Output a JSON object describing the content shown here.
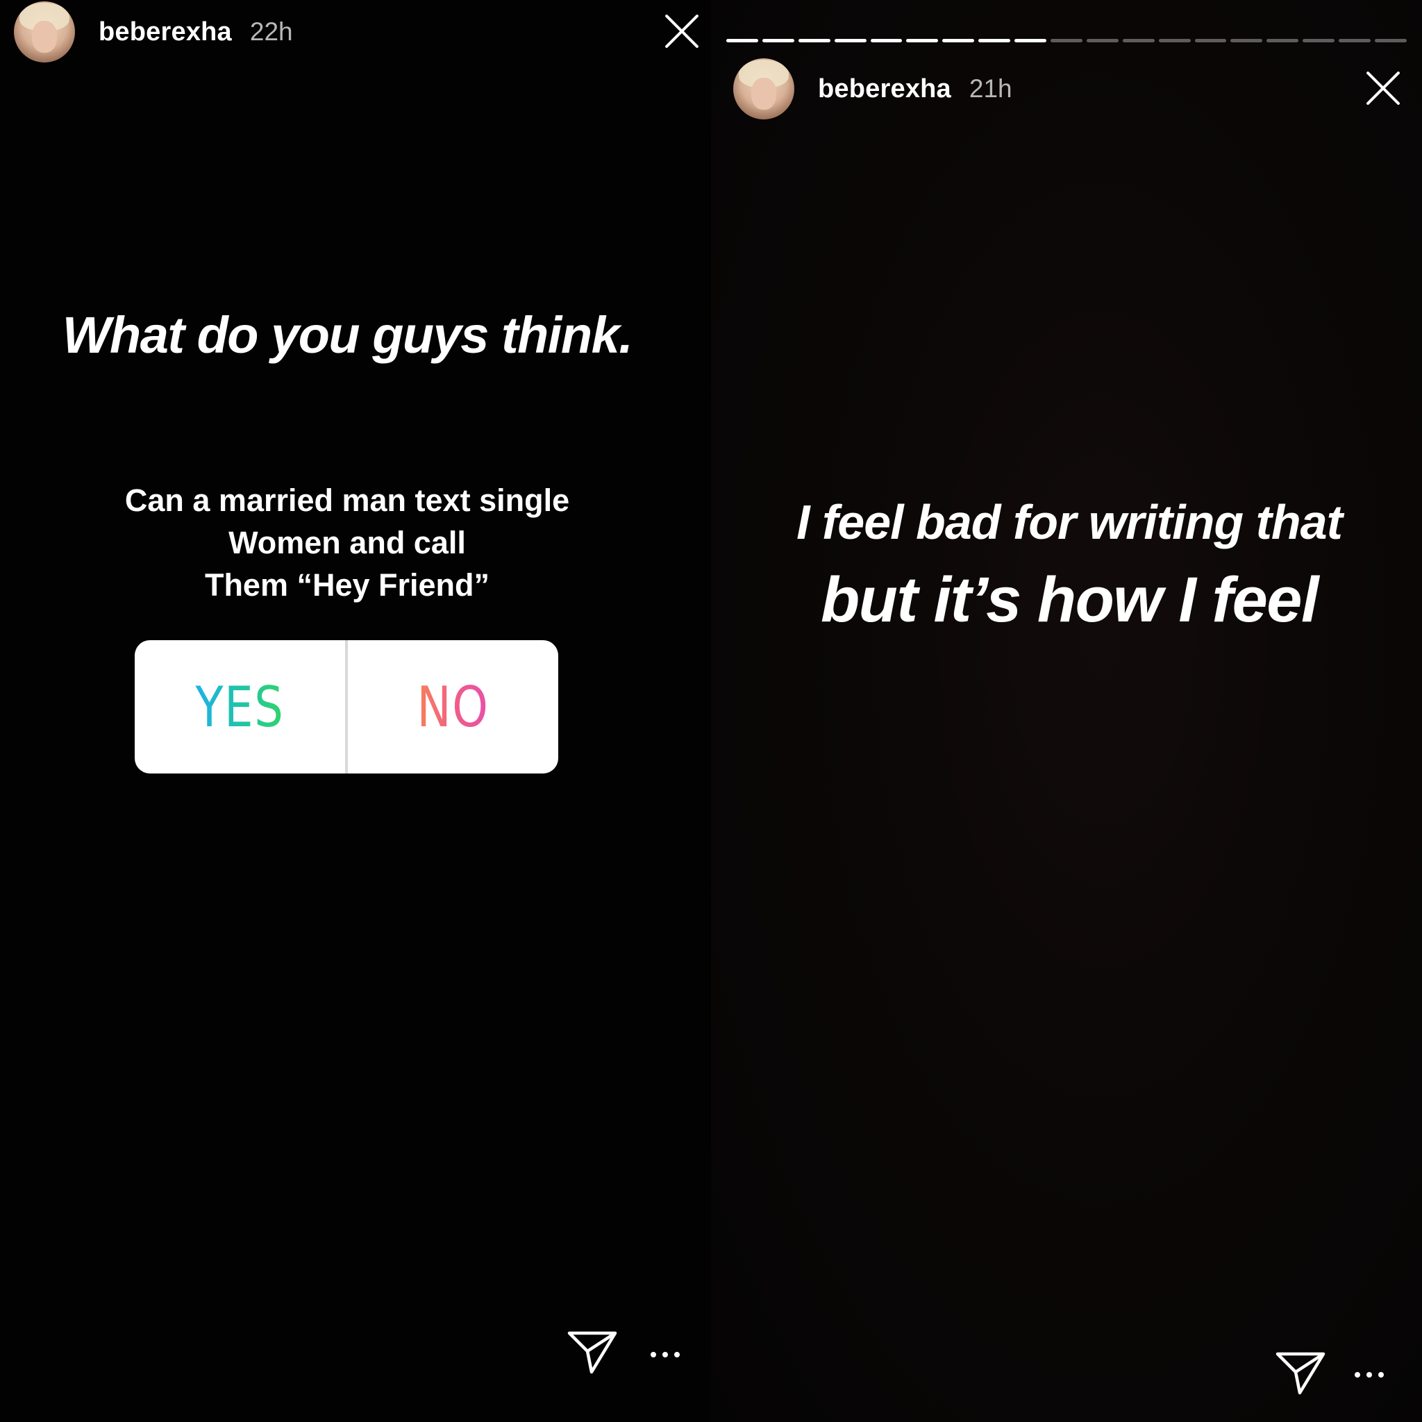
{
  "left_story": {
    "username": "beberexha",
    "time": "22h",
    "title": "What do you guys think.",
    "question_lines": [
      "Can a married man text single",
      "Women and call",
      "Them “Hey Friend”"
    ],
    "poll": {
      "yes_label": "YES",
      "no_label": "NO"
    },
    "icons": {
      "close": "close-icon",
      "share": "send-icon",
      "more": "more-icon"
    }
  },
  "right_story": {
    "username": "beberexha",
    "time": "21h",
    "progress": {
      "total_segments": 19,
      "completed_segments": 9
    },
    "text_lines": [
      "I feel bad for writing that",
      "but it’s how I feel"
    ],
    "icons": {
      "close": "close-icon",
      "share": "send-icon",
      "more": "more-icon"
    }
  },
  "colors": {
    "yes_gradient": [
      "#1cb2e8",
      "#34d36a"
    ],
    "no_gradient": [
      "#f6805a",
      "#e94fab"
    ]
  }
}
